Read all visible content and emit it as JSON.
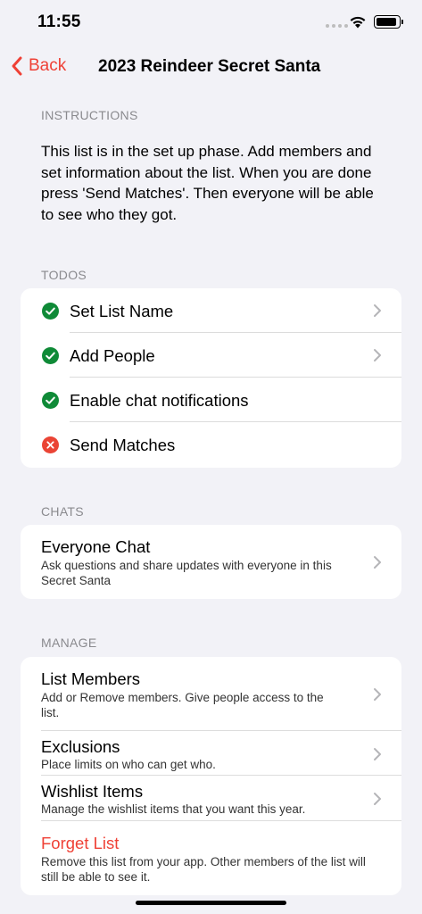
{
  "status_bar": {
    "time": "11:55"
  },
  "nav": {
    "back_label": "Back",
    "title": "2023 Reindeer Secret Santa"
  },
  "instructions": {
    "header": "INSTRUCTIONS",
    "text": "This list is in the set up phase. Add members and set information about the list. When you are done press 'Send Matches'. Then everyone will be able to see who they got."
  },
  "todos": {
    "header": "TODOS",
    "items": [
      {
        "label": "Set List Name",
        "status": "done"
      },
      {
        "label": "Add People",
        "status": "done"
      },
      {
        "label": "Enable chat notifications",
        "status": "done"
      },
      {
        "label": "Send Matches",
        "status": "incomplete"
      }
    ]
  },
  "chats": {
    "header": "CHATS",
    "items": [
      {
        "title": "Everyone Chat",
        "subtitle": "Ask questions and share updates with everyone in this Secret Santa"
      }
    ]
  },
  "manage": {
    "header": "MANAGE",
    "items": [
      {
        "title": "List Members",
        "subtitle": "Add or Remove members. Give people access to the list."
      },
      {
        "title": "Exclusions",
        "subtitle": "Place limits on who can get who."
      },
      {
        "title": "Wishlist Items",
        "subtitle": "Manage the wishlist items that you want this year."
      },
      {
        "title": "Forget List",
        "subtitle": "Remove this list from your app. Other members of the list will still be able to see it."
      }
    ]
  },
  "colors": {
    "accent": "#ef4136",
    "done": "#0f8a37",
    "incomplete": "#ea4435",
    "background": "#f2f2f7"
  }
}
